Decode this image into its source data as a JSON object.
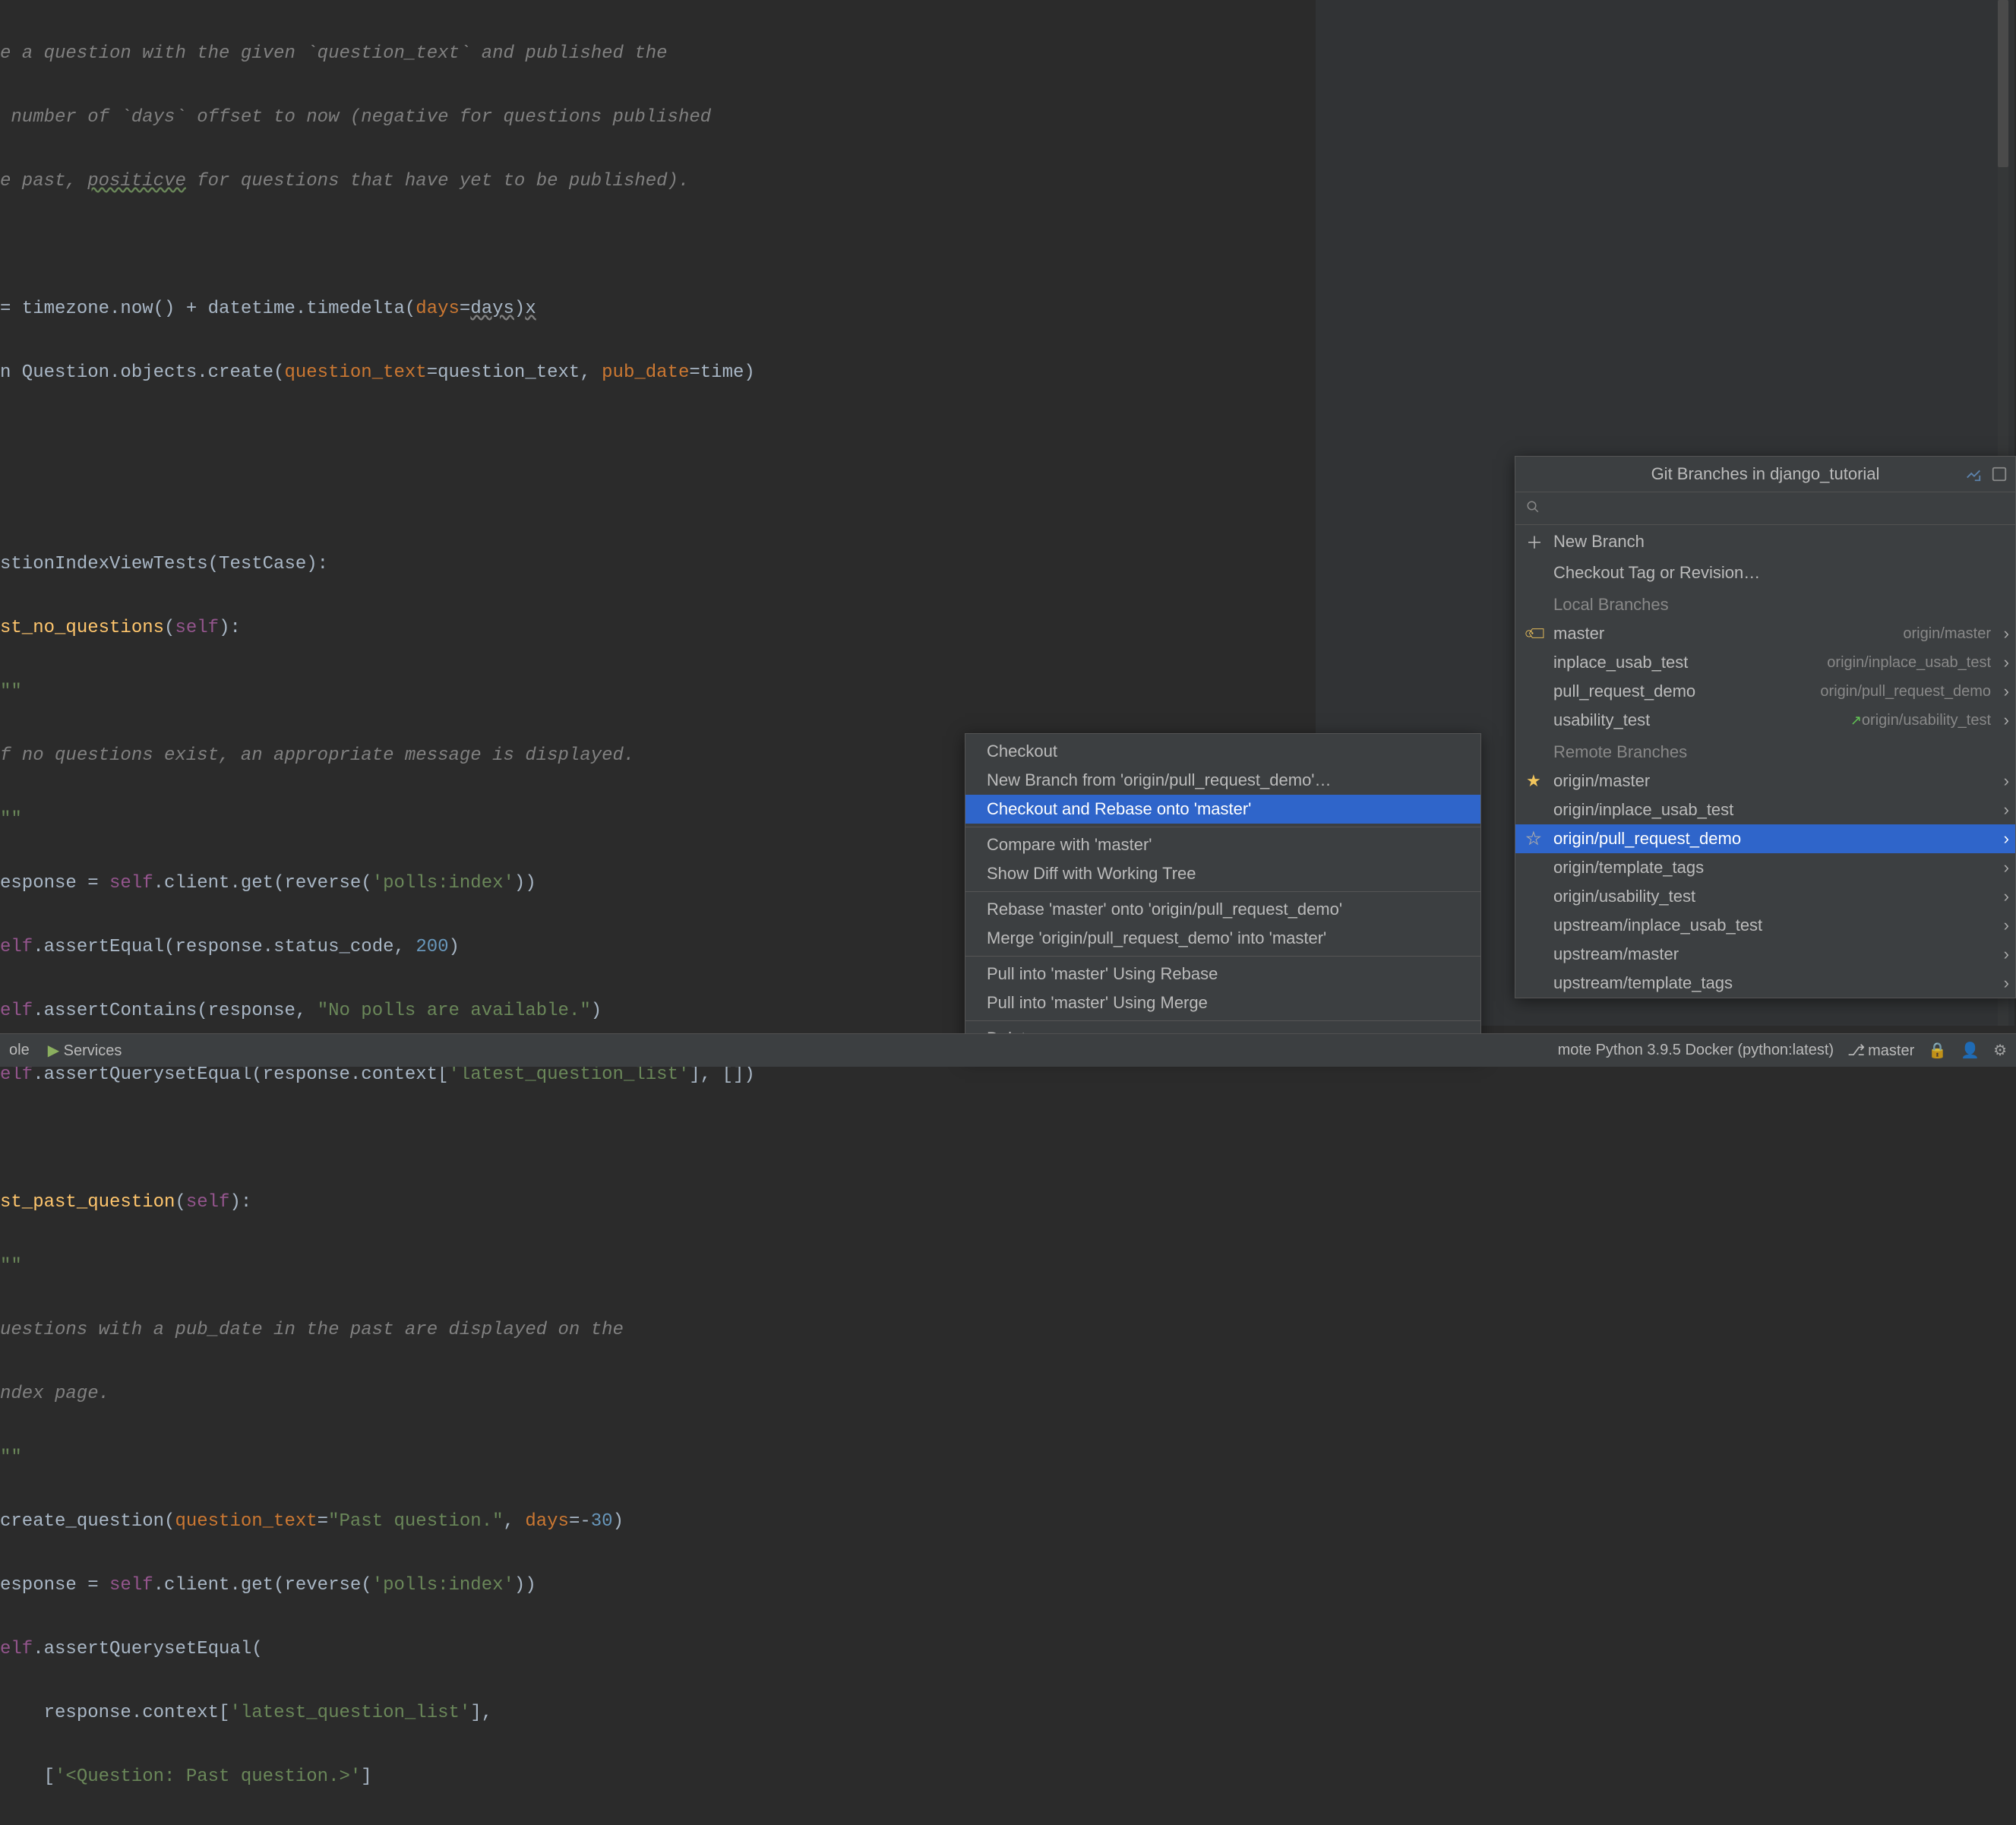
{
  "code": {
    "l1": "e a question with the given `question_text` and published the",
    "l2": " number of `days` offset to now (negative for questions published",
    "l3a": "e past, ",
    "l3b": "positicve",
    "l3c": " for questions that have yet to be published).",
    "l4a": "= timezone.now() + datetime.timedelta(",
    "l4b": "days",
    "l4c": "=",
    "l4d": "days",
    "l4e": ")",
    "l4f": "x",
    "l5a": "n Question.objects.create(",
    "l5b": "question_text",
    "l5c": "=question_text, ",
    "l5d": "pub_date",
    "l5e": "=time)",
    "l6a": "stionIndexViewTests(TestCase):",
    "l7a": "st_no_questions",
    "l7b": "(",
    "l7c": "self",
    "l7d": "):",
    "l8": "\"\"",
    "l9": "f no questions exist, an appropriate message is displayed.",
    "l10": "\"\"",
    "l11a": "esponse = ",
    "l11b": "self",
    "l11c": ".client.get(reverse(",
    "l11d": "'polls:index'",
    "l11e": "))",
    "l12a": "elf",
    "l12b": ".assertEqual(response.status_code, ",
    "l12c": "200",
    "l12d": ")",
    "l13a": "elf",
    "l13b": ".assertContains(response, ",
    "l13c": "\"No polls are available.\"",
    "l13d": ")",
    "l14a": "elf",
    "l14b": ".assertQuerysetEqual(response.context[",
    "l14c": "'latest_question_list'",
    "l14d": "], [])",
    "l15a": "st_past_question",
    "l15b": "(",
    "l15c": "self",
    "l15d": "):",
    "l16": "\"\"",
    "l17": "uestions with a pub_date in the past are displayed on the",
    "l18": "ndex page.",
    "l19": "\"\"",
    "l20a": "create_question(",
    "l20b": "question_text",
    "l20c": "=",
    "l20d": "\"Past question.\"",
    "l20e": ", ",
    "l20f": "days",
    "l20g": "=-",
    "l20h": "30",
    "l20i": ")",
    "l21a": "esponse = ",
    "l21b": "self",
    "l21c": ".client.get(reverse(",
    "l21d": "'polls:index'",
    "l21e": "))",
    "l22a": "elf",
    "l22b": ".assertQuerysetEqual(",
    "l23a": "    response.context[",
    "l23b": "'latest_question_list'",
    "l23c": "],",
    "l24a": "    [",
    "l24b": "'<Question: Past question.>'",
    "l24c": "]"
  },
  "branches": {
    "title": "Git Branches in django_tutorial",
    "new_branch": "New Branch",
    "checkout_tag": "Checkout Tag or Revision…",
    "local_heading": "Local Branches",
    "remote_heading": "Remote Branches",
    "local": [
      {
        "label": "master",
        "tracking": "origin/master",
        "tagged": true
      },
      {
        "label": "inplace_usab_test",
        "tracking": "origin/inplace_usab_test"
      },
      {
        "label": "pull_request_demo",
        "tracking": "origin/pull_request_demo"
      },
      {
        "label": "usability_test",
        "tracking": "origin/usability_test",
        "outgoing": true
      }
    ],
    "remote": [
      {
        "label": "origin/master",
        "star": true
      },
      {
        "label": "origin/inplace_usab_test"
      },
      {
        "label": "origin/pull_request_demo",
        "selected": true,
        "star_outline": true
      },
      {
        "label": "origin/template_tags"
      },
      {
        "label": "origin/usability_test"
      },
      {
        "label": "upstream/inplace_usab_test"
      },
      {
        "label": "upstream/master"
      },
      {
        "label": "upstream/template_tags"
      }
    ]
  },
  "context_menu": {
    "items": [
      "Checkout",
      "New Branch from 'origin/pull_request_demo'…",
      "Checkout and Rebase onto 'master'",
      "Compare with 'master'",
      "Show Diff with Working Tree",
      "Rebase 'master' onto 'origin/pull_request_demo'",
      "Merge 'origin/pull_request_demo' into 'master'",
      "Pull into 'master' Using Rebase",
      "Pull into 'master' Using Merge",
      "Delete"
    ],
    "selected_index": 2,
    "separators_after": [
      2,
      4,
      6,
      8
    ]
  },
  "bottom": {
    "console": "ole",
    "services": "Services",
    "interpreter": "mote Python 3.9.5 Docker (python:latest)",
    "branch": "master"
  }
}
